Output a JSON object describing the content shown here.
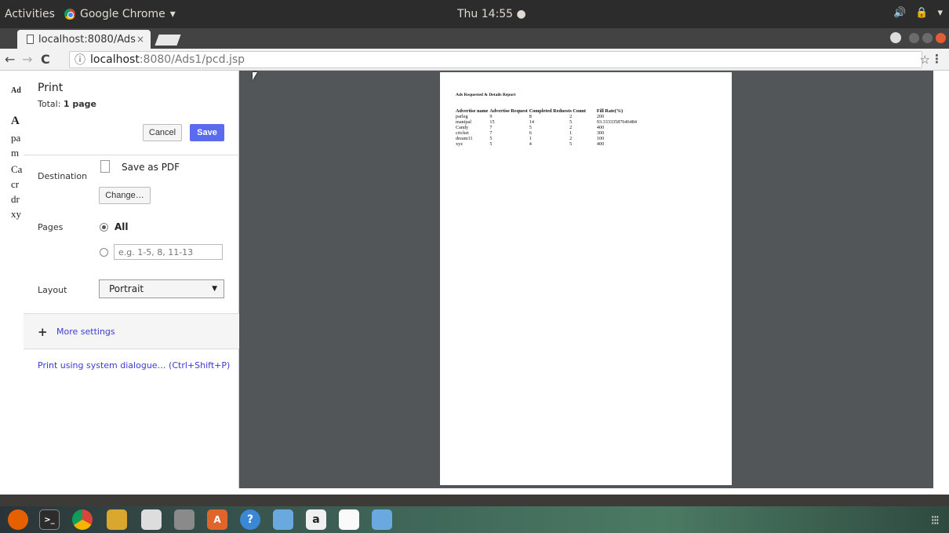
{
  "topbar": {
    "activities": "Activities",
    "app_name": "Google Chrome",
    "app_caret": "▾",
    "clock": "Thu 14:55 ●",
    "tray": [
      "🔊",
      "🔒",
      "▾"
    ]
  },
  "browser": {
    "tab_title": "localhost:8080/Ads",
    "tab_close": "×",
    "url_info_icon": "ⓘ",
    "url_host": "localhost",
    "url_path": ":8080/Ads1/pcd.jsp",
    "back": "←",
    "forward": "→",
    "reload": "C",
    "star": "☆",
    "menu": "⋮"
  },
  "page_behind": {
    "fragments": [
      "Ad",
      "A",
      "pa",
      "m",
      "Ca",
      "cr",
      "dr",
      "xy"
    ]
  },
  "print": {
    "title": "Print",
    "total_label": "Total:",
    "total_value": "1 page",
    "cancel": "Cancel",
    "save": "Save",
    "destination_label": "Destination",
    "destination_value": "Save as PDF",
    "change": "Change…",
    "pages_label": "Pages",
    "pages_all": "All",
    "pages_placeholder": "e.g. 1-5, 8, 11-13",
    "layout_label": "Layout",
    "layout_value": "Portrait",
    "more_settings": "More settings",
    "system_dialog": "Print using system dialogue… (Ctrl+Shift+P)"
  },
  "report": {
    "title": "Ads Requested & Details Report",
    "headers": [
      "Advertise name",
      "Advertise Request",
      "Completed Reduests Count",
      "Fill Rate(%)"
    ],
    "rows": [
      [
        "parleg",
        "9",
        "8",
        "2",
        "200"
      ],
      [
        "manipal",
        "15",
        "14",
        "5",
        "93.33333587646484"
      ],
      [
        "Candy",
        "7",
        "5",
        "2",
        "400"
      ],
      [
        "cricket",
        "7",
        "6",
        "1",
        "300"
      ],
      [
        "dream11",
        "5",
        "1",
        "2",
        "100"
      ],
      [
        "xyz",
        "5",
        "4",
        "5",
        "400"
      ]
    ]
  },
  "dock": {
    "icons": [
      "firefox-icon",
      "terminal-icon",
      "chrome-icon",
      "screenshot-icon",
      "camera-icon",
      "files-icon",
      "software-icon",
      "help-icon",
      "virtualbox-icon",
      "amazon-icon",
      "document-icon",
      "virtualbox2-icon"
    ],
    "apps_grid": "⁝⁝⁝"
  }
}
